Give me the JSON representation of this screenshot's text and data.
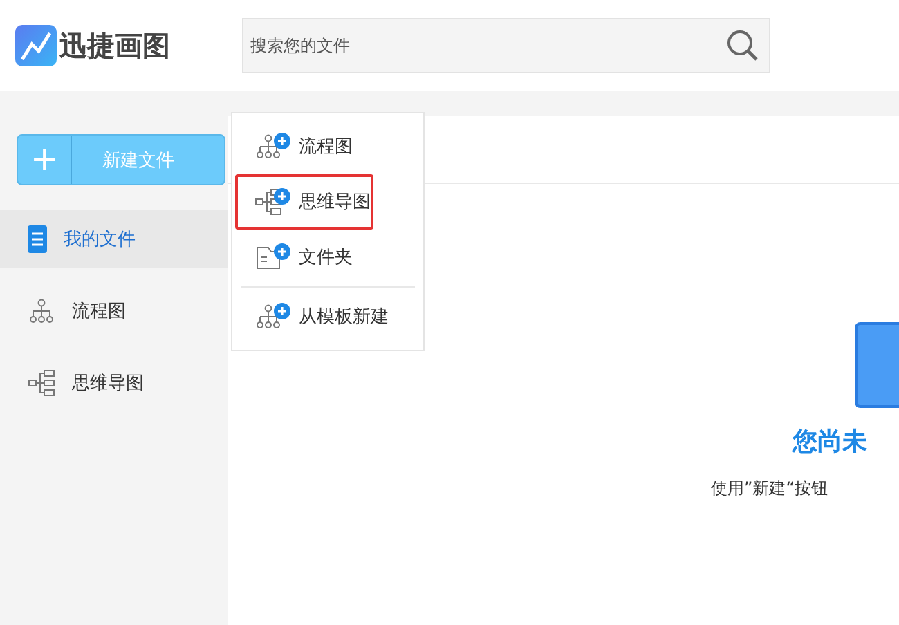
{
  "header": {
    "logo_text": "迅捷画图",
    "search": {
      "placeholder": "搜索您的文件"
    }
  },
  "new_button": {
    "icon": "+",
    "label": "新建文件"
  },
  "sidebar": {
    "items": [
      {
        "label": "我的文件",
        "kind": "file",
        "selected": true
      },
      {
        "label": "流程图",
        "kind": "flow",
        "selected": false
      },
      {
        "label": "思维导图",
        "kind": "mind",
        "selected": false
      }
    ]
  },
  "new_menu": {
    "items": [
      {
        "label": "流程图",
        "kind": "flow",
        "selected": false
      },
      {
        "label": "思维导图",
        "kind": "mind",
        "selected": true
      },
      {
        "label": "文件夹",
        "kind": "folder",
        "selected": false
      },
      {
        "label": "从模板新建",
        "kind": "flow",
        "selected": false
      }
    ]
  },
  "empty_state": {
    "title": "您尚未",
    "hint": "使用”新建“按钮"
  }
}
